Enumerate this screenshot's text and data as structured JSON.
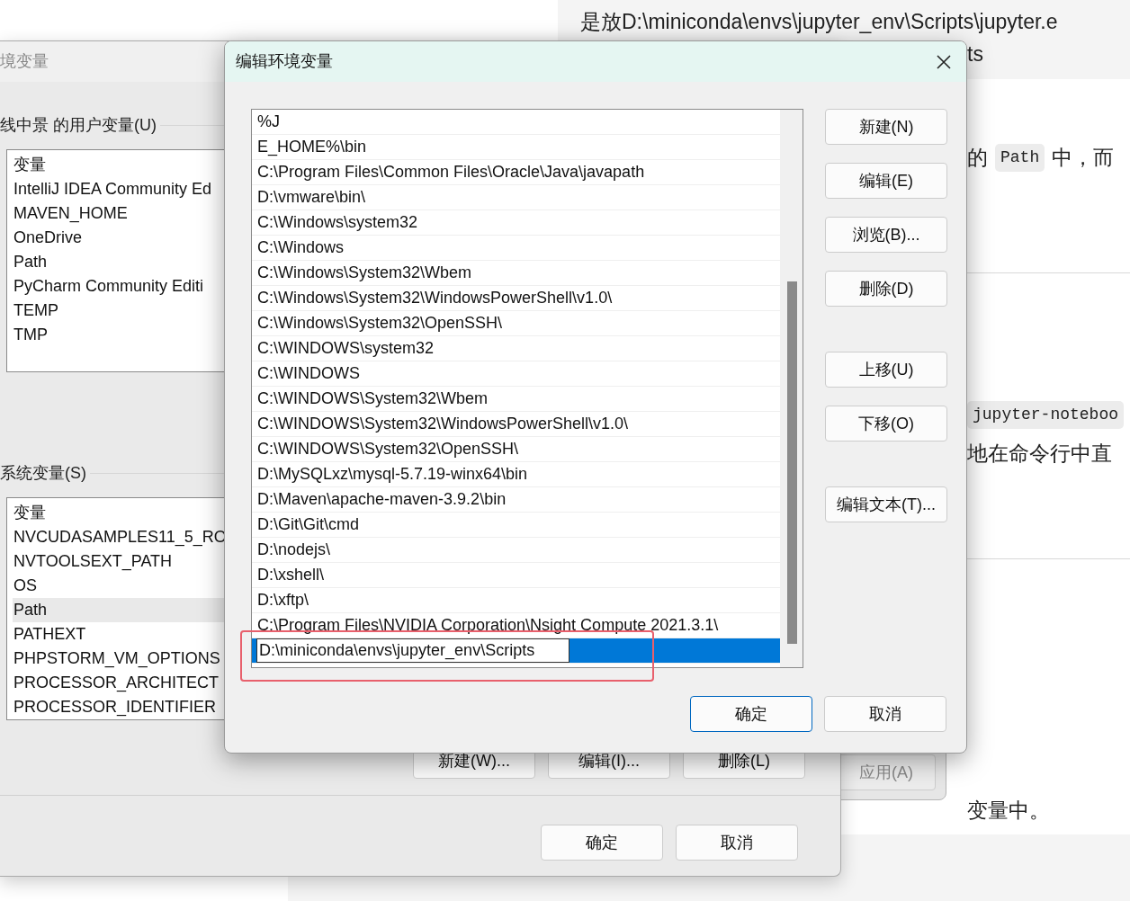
{
  "background_page": {
    "message_lines": [
      "是放D:\\miniconda\\envs\\jupyter_env\\Scripts\\jupyter.e",
      "ts"
    ],
    "paragraphs": [
      {
        "parts": [
          {
            "kind": "text",
            "text": "的"
          },
          {
            "kind": "code",
            "text": "Path"
          },
          {
            "kind": "text",
            "text": "中，而"
          }
        ]
      },
      {
        "parts": [
          {
            "kind": "code",
            "text": "jupyter-noteboo"
          }
        ]
      },
      {
        "parts": [
          {
            "kind": "text",
            "text": "地在命令行中直"
          }
        ]
      },
      {
        "parts": [
          {
            "kind": "text",
            "text": "变量中。"
          }
        ]
      }
    ]
  },
  "back_window": {
    "button": {
      "label": "应用(A)",
      "disabled": true
    }
  },
  "env_window": {
    "title": "境变量",
    "user_section": {
      "label": "线中景 的用户变量(U)",
      "header": "变量",
      "items": [
        {
          "text": "IntelliJ IDEA Community Ed",
          "selected": false
        },
        {
          "text": "MAVEN_HOME",
          "selected": false
        },
        {
          "text": "OneDrive",
          "selected": false
        },
        {
          "text": "Path",
          "selected": false
        },
        {
          "text": "PyCharm Community Editi",
          "selected": false
        },
        {
          "text": "TEMP",
          "selected": false
        },
        {
          "text": "TMP",
          "selected": false
        }
      ]
    },
    "system_section": {
      "label": "系统变量(S)",
      "header": "变量",
      "items": [
        {
          "text": "NVCUDASAMPLES11_5_RO",
          "selected": false
        },
        {
          "text": "NVTOOLSEXT_PATH",
          "selected": false
        },
        {
          "text": "OS",
          "selected": false
        },
        {
          "text": "Path",
          "selected": true
        },
        {
          "text": "PATHEXT",
          "selected": false
        },
        {
          "text": "PHPSTORM_VM_OPTIONS",
          "selected": false
        },
        {
          "text": "PROCESSOR_ARCHITECT",
          "selected": false
        },
        {
          "text": "PROCESSOR_IDENTIFIER",
          "selected": false
        }
      ]
    },
    "section_buttons": [
      "新建(W)...",
      "编辑(I)...",
      "删除(L)"
    ],
    "footer_buttons": [
      "确定",
      "取消"
    ]
  },
  "edit_dialog": {
    "title": "编辑环境变量",
    "entries": [
      {
        "text": "%J",
        "selected": false,
        "editing": false
      },
      {
        "text": "E_HOME%\\bin",
        "selected": false,
        "editing": false
      },
      {
        "text": "C:\\Program Files\\Common Files\\Oracle\\Java\\javapath",
        "selected": false,
        "editing": false
      },
      {
        "text": "D:\\vmware\\bin\\",
        "selected": false,
        "editing": false
      },
      {
        "text": "C:\\Windows\\system32",
        "selected": false,
        "editing": false
      },
      {
        "text": "C:\\Windows",
        "selected": false,
        "editing": false
      },
      {
        "text": "C:\\Windows\\System32\\Wbem",
        "selected": false,
        "editing": false
      },
      {
        "text": "C:\\Windows\\System32\\WindowsPowerShell\\v1.0\\",
        "selected": false,
        "editing": false
      },
      {
        "text": "C:\\Windows\\System32\\OpenSSH\\",
        "selected": false,
        "editing": false
      },
      {
        "text": "C:\\WINDOWS\\system32",
        "selected": false,
        "editing": false
      },
      {
        "text": "C:\\WINDOWS",
        "selected": false,
        "editing": false
      },
      {
        "text": "C:\\WINDOWS\\System32\\Wbem",
        "selected": false,
        "editing": false
      },
      {
        "text": "C:\\WINDOWS\\System32\\WindowsPowerShell\\v1.0\\",
        "selected": false,
        "editing": false
      },
      {
        "text": "C:\\WINDOWS\\System32\\OpenSSH\\",
        "selected": false,
        "editing": false
      },
      {
        "text": "D:\\MySQLxz\\mysql-5.7.19-winx64\\bin",
        "selected": false,
        "editing": false
      },
      {
        "text": "D:\\Maven\\apache-maven-3.9.2\\bin",
        "selected": false,
        "editing": false
      },
      {
        "text": "D:\\Git\\Git\\cmd",
        "selected": false,
        "editing": false
      },
      {
        "text": "D:\\nodejs\\",
        "selected": false,
        "editing": false
      },
      {
        "text": "D:\\xshell\\",
        "selected": false,
        "editing": false
      },
      {
        "text": "D:\\xftp\\",
        "selected": false,
        "editing": false
      },
      {
        "text": "C:\\Program Files\\NVIDIA Corporation\\Nsight Compute 2021.3.1\\",
        "selected": false,
        "editing": false
      },
      {
        "text": "D:\\miniconda\\envs\\jupyter_env\\Scripts",
        "selected": true,
        "editing": true
      }
    ],
    "side_button_groups": [
      [
        "新建(N)",
        "编辑(E)",
        "浏览(B)...",
        "删除(D)"
      ],
      [
        "上移(U)",
        "下移(O)"
      ],
      [
        "编辑文本(T)..."
      ]
    ],
    "footer_buttons": [
      {
        "label": "确定",
        "default": true
      },
      {
        "label": "取消",
        "default": false
      }
    ]
  }
}
